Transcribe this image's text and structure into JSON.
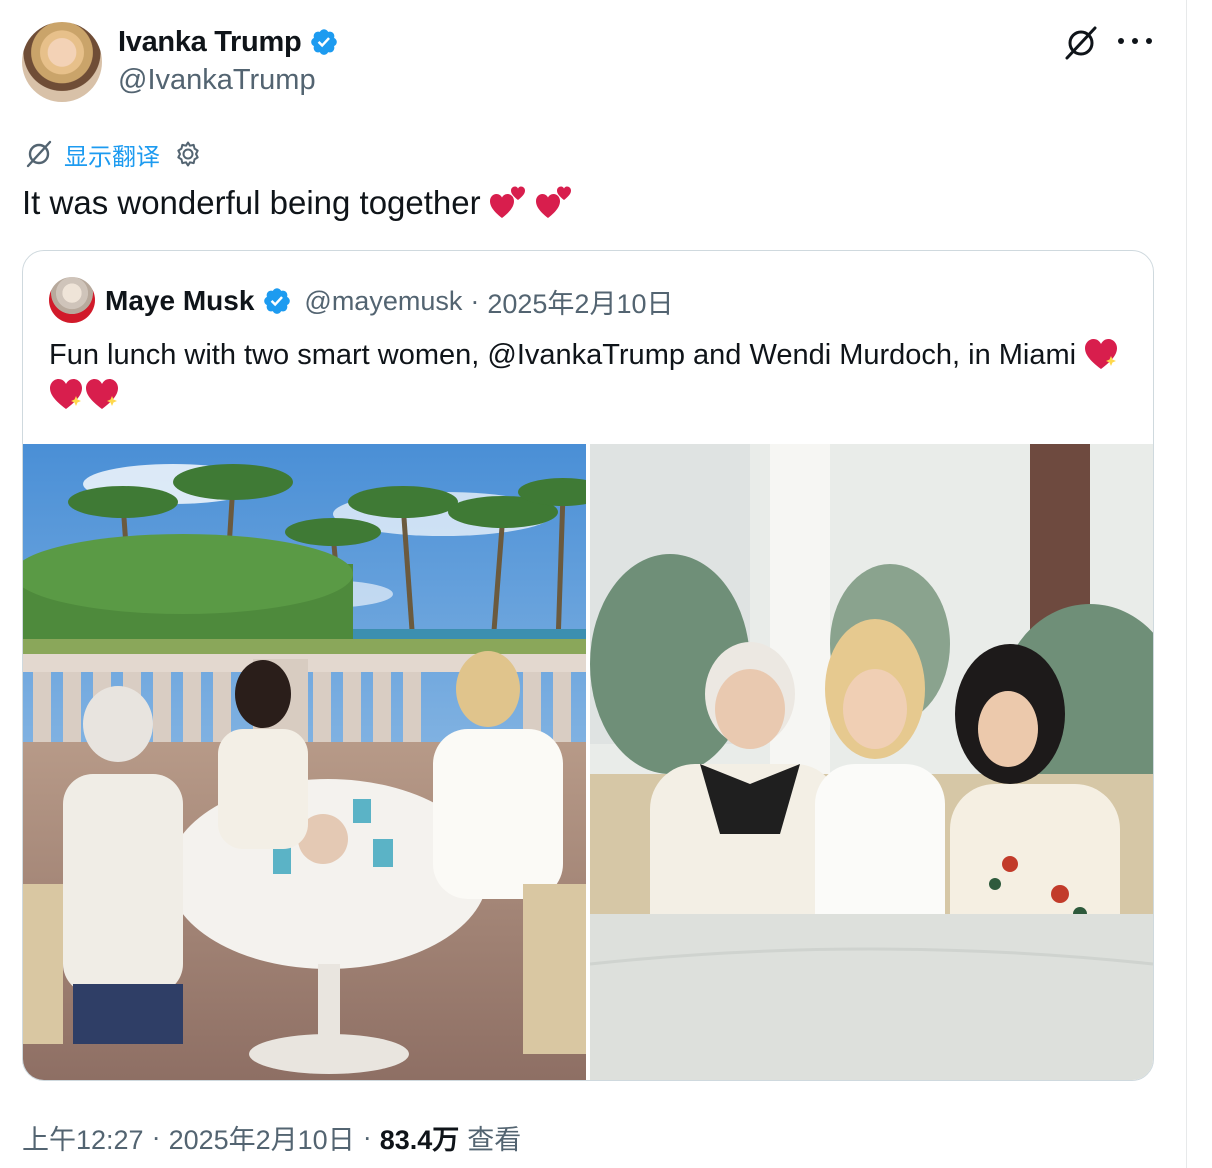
{
  "author": {
    "name": "Ivanka Trump",
    "handle": "@IvankaTrump"
  },
  "translate": {
    "label": "显示翻译"
  },
  "tweet": {
    "text": "It was wonderful being together",
    "emoji": "heart-two-hearts"
  },
  "quote": {
    "name": "Maye Musk",
    "handle": "@mayemusk",
    "separator": "·",
    "date": "2025年2月10日",
    "text": "Fun lunch with two smart women, @IvankaTrump and Wendi Murdoch, in Miami",
    "emoji": "sparkling-heart"
  },
  "footer": {
    "time": "上午12:27",
    "sep1": "·",
    "date": "2025年2月10日",
    "sep2": "·",
    "views_count": "83.4万",
    "views_label": "查看"
  },
  "colors": {
    "accent": "#1d9bf0",
    "muted": "#536471",
    "text": "#0f1419",
    "heart": "#d81e4d"
  },
  "icons": [
    "verified-badge-icon",
    "grok-icon",
    "more-icon",
    "translate-globe-icon",
    "settings-gear-icon"
  ]
}
